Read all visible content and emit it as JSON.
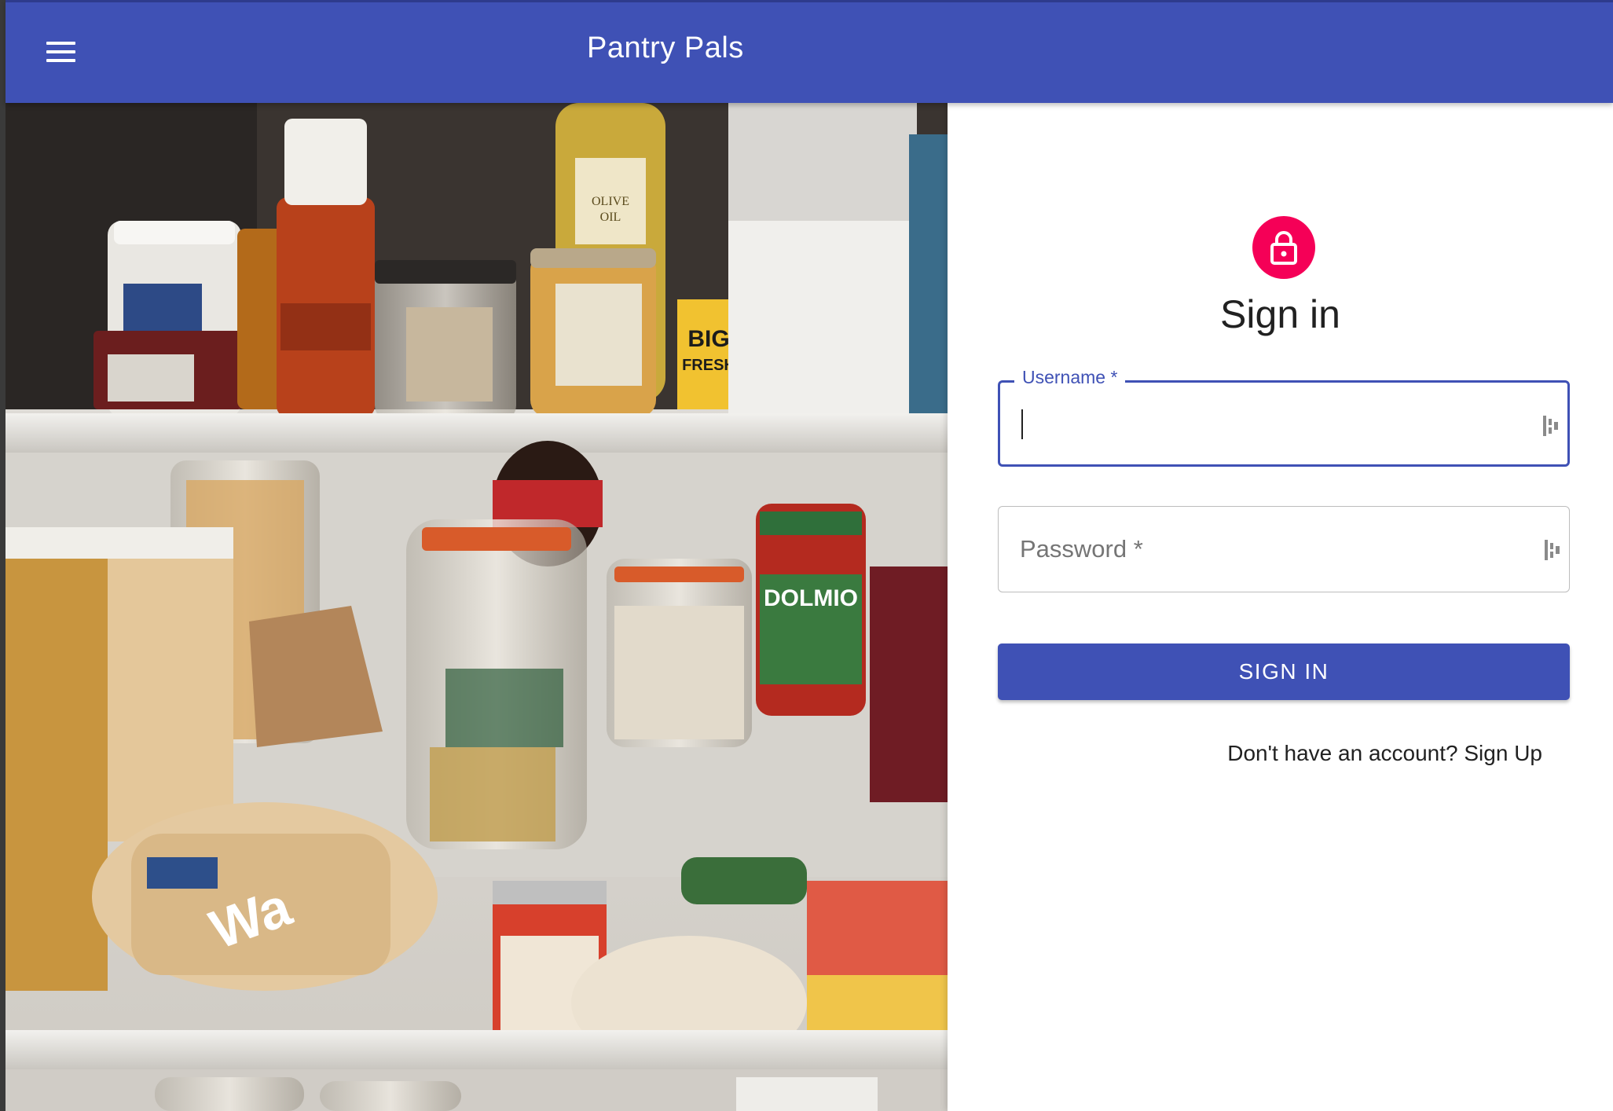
{
  "appbar": {
    "title": "Pantry Pals",
    "menu_icon": "menu-icon",
    "color": "#3f51b5"
  },
  "photo": {
    "description_icon": "pantry-photo"
  },
  "form": {
    "avatar_icon": "lock-icon",
    "avatar_color": "#f50057",
    "title": "Sign in",
    "username": {
      "label": "Username *",
      "value": ""
    },
    "password": {
      "label": "Password *",
      "value": ""
    },
    "password_manager_icon": "password-manager-icon",
    "submit_label": "SIGN IN",
    "signup_link": "Don't have an account? Sign Up"
  }
}
